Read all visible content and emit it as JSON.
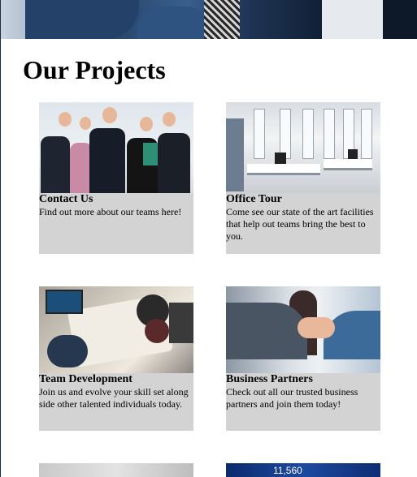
{
  "page": {
    "title": "Our Projects"
  },
  "projects": [
    {
      "title": "Contact Us",
      "description": "Find out more about our teams here!",
      "image": "team-group-photo"
    },
    {
      "title": "Office Tour",
      "description": "Come see our state of the art facilities that help out teams bring the best to you.",
      "image": "office-interior-photo"
    },
    {
      "title": "Team Development",
      "description": "Join us and evolve your skill set along side other talented individuals today.",
      "image": "team-meeting-photo"
    },
    {
      "title": "Business Partners",
      "description": "Check out all our trusted business partners and join them today!",
      "image": "handshake-photo"
    }
  ],
  "partial": {
    "ticker": "11,560"
  }
}
